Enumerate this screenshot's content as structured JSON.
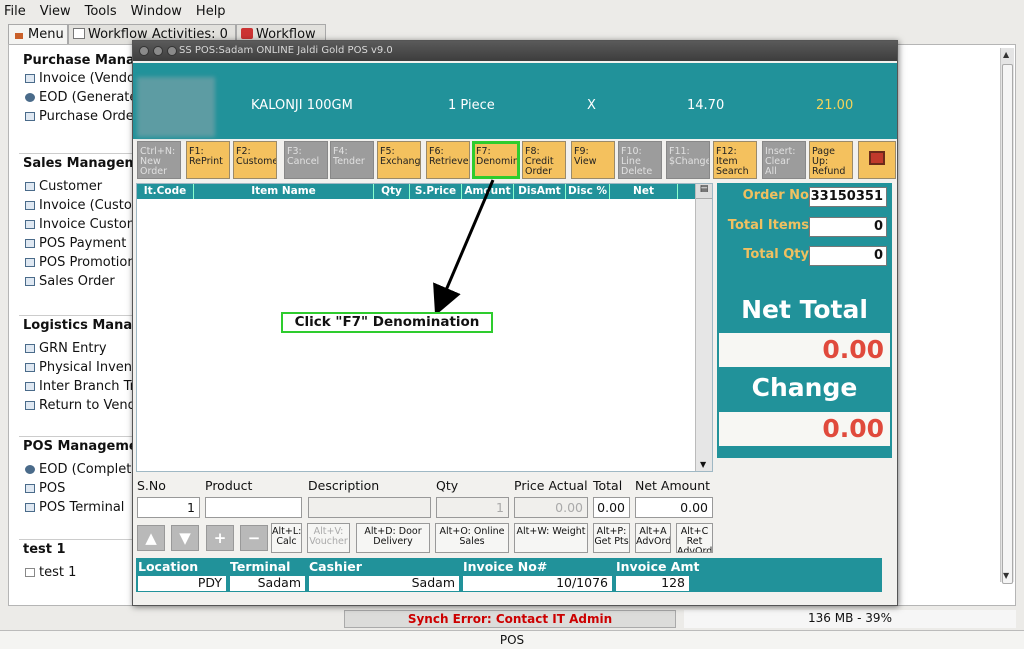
{
  "menubar": {
    "file": "File",
    "view": "View",
    "tools": "Tools",
    "window": "Window",
    "help": "Help"
  },
  "tabs": [
    {
      "label": "Menu"
    },
    {
      "label": "Workflow Activities: 0"
    },
    {
      "label": "Workflow"
    }
  ],
  "sidebar": {
    "purchase": {
      "title": "Purchase Management",
      "items": [
        "Invoice (Vendor)",
        "EOD (Generate)",
        "Purchase Order"
      ]
    },
    "sales": {
      "title": "Sales Management",
      "items": [
        "Customer",
        "Invoice (Customer)",
        "Invoice Customer",
        "POS Payment",
        "POS Promotion",
        "Sales Order"
      ]
    },
    "logistics": {
      "title": "Logistics Management",
      "items": [
        "GRN Entry",
        "Physical Inventory",
        "Inter Branch Transfer",
        "Return to Vendor"
      ]
    },
    "pos": {
      "title": "POS Management",
      "items": [
        "EOD (Complete)",
        "POS",
        "POS Terminal"
      ]
    },
    "test": {
      "title": "test 1",
      "items": [
        "test 1"
      ]
    }
  },
  "pos_window": {
    "title": "SS POS:Sadam   ONLINE Jaldi Gold POS v9.0",
    "item": {
      "name": "KALONJI 100GM",
      "qty": "1 Piece",
      "x": "X",
      "price": "14.70",
      "total": "21.00"
    },
    "fkeys": [
      {
        "label": "Ctrl+N: New Order",
        "enabled": false
      },
      {
        "label": "F1: RePrint",
        "enabled": true
      },
      {
        "label": "F2: Customer",
        "enabled": true
      },
      {
        "label": "F3: Cancel",
        "enabled": false
      },
      {
        "label": "F4: Tender",
        "enabled": false
      },
      {
        "label": "F5: Exchange",
        "enabled": true
      },
      {
        "label": "F6: Retrieve",
        "enabled": true
      },
      {
        "label": "F7: Denomination",
        "enabled": true
      },
      {
        "label": "F8: Credit Order",
        "enabled": true
      },
      {
        "label": "F9: View",
        "enabled": true
      },
      {
        "label": "F10: Line Delete",
        "enabled": false
      },
      {
        "label": "F11: $Change",
        "enabled": false
      },
      {
        "label": "F12: Item Search",
        "enabled": true
      },
      {
        "label": "Insert: Clear All",
        "enabled": false
      },
      {
        "label": "Page Up: Refund",
        "enabled": true
      }
    ],
    "grid_columns": [
      "It.Code",
      "Item Name",
      "Qty",
      "S.Price",
      "Amount",
      "DisAmt",
      "Disc %",
      "Net Amount"
    ],
    "summary": {
      "order_no_label": "Order No",
      "order_no": "33150351",
      "total_items_label": "Total Items",
      "total_items": "0",
      "total_qty_label": "Total Qty",
      "total_qty": "0",
      "net_total_label": "Net Total",
      "net_total": "0.00",
      "change_label": "Change",
      "change": "0.00"
    },
    "entry": {
      "sno_label": "S.No",
      "sno": "1",
      "product_label": "Product",
      "product": "",
      "description_label": "Description",
      "description": "",
      "qty_label": "Qty",
      "qty": "1",
      "price_actual_label": "Price Actual",
      "price_actual": "0.00",
      "total_label": "Total",
      "total": "0.00",
      "net_amount_label": "Net Amount",
      "net_amount": "0.00"
    },
    "actions": [
      {
        "label": "Alt+L: Calc",
        "enabled": true
      },
      {
        "label": "Alt+V: Voucher",
        "enabled": false
      },
      {
        "label": "Alt+D: Door Delivery",
        "enabled": true
      },
      {
        "label": "Alt+O: Online Sales",
        "enabled": true
      },
      {
        "label": "Alt+W: Weight",
        "enabled": true
      },
      {
        "label": "Alt+P: Get Pts",
        "enabled": true
      },
      {
        "label": "Alt+A AdvOrd",
        "enabled": true
      },
      {
        "label": "Alt+C Ret AdvOrd",
        "enabled": true
      }
    ],
    "info": {
      "location_label": "Location",
      "location": "PDY",
      "terminal_label": "Terminal",
      "terminal": "Sadam",
      "cashier_label": "Cashier",
      "cashier": "Sadam",
      "invoice_no_label": "Invoice No#",
      "invoice_no": "10/1076",
      "invoice_amt_label": "Invoice Amt",
      "invoice_amt": "128"
    }
  },
  "annotation": {
    "text": "Click \"F7\" Denomination"
  },
  "status": {
    "synch": "Synch Error: Contact IT Admin",
    "memory": "136 MB - 39%",
    "footer": "POS"
  },
  "colors": {
    "teal": "#21929a",
    "fkey": "#f4c15e",
    "highlight": "#2ecc2e",
    "error": "#cc0000",
    "amount": "#e04a3c"
  }
}
